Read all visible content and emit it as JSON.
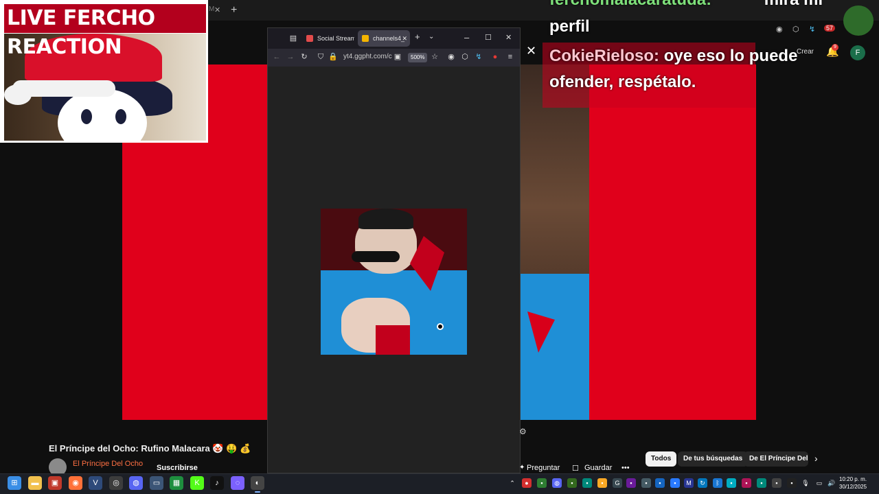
{
  "overlay": {
    "stream_title": "LIVE FERCHO REACTION",
    "chat_lines": [
      {
        "name": "ferchomalacaratuda:",
        "text": "mira mi"
      },
      {
        "name": "",
        "text": "perfil"
      },
      {
        "name": "CokieRieloso:",
        "text": "oye eso lo puede"
      },
      {
        "name": "",
        "text": "ofender, respétalo."
      }
    ]
  },
  "browser_window": {
    "tabs": [
      {
        "label": "Social Stream",
        "active": false,
        "fav_color": "#e24b4b"
      },
      {
        "label": "channels4_",
        "active": true,
        "fav_color": "#f4b400"
      }
    ],
    "url": "yt4.ggpht.com/c",
    "zoom": "500%",
    "new_tab_symbol": "+",
    "controls": {
      "minimize": "–",
      "maximize": "☐",
      "close": "✕"
    }
  },
  "youtube": {
    "video_title": "El Príncipe del Ocho: Rufino Malacara 🤡 🤑 💰",
    "channel_name": "El Príncipe Del Ocho",
    "subscribe_label": "Suscribirse",
    "ask_label": "Preguntar",
    "save_label": "Guardar",
    "more_label": "•••",
    "chips": [
      "Todos",
      "De tus búsquedas",
      "De El Príncipe Del O"
    ],
    "create_label": "Crear",
    "notification_count": "9",
    "avatar_initial": "F",
    "top_badge": "57",
    "close_symbol": "✕"
  },
  "bg_browser": {
    "tab_fragment": "M",
    "tab_close": "✕",
    "new_tab": "+"
  },
  "taskbar": {
    "time": "10:20 p. m.",
    "date": "30/12/2025",
    "apps": [
      {
        "icon": "windows-start-icon",
        "glyph": "⊞",
        "color": "#3a8ee6"
      },
      {
        "icon": "file-explorer-icon",
        "glyph": "▬",
        "color": "#f2c14e"
      },
      {
        "icon": "app-icon",
        "glyph": "▣",
        "color": "#c0392b"
      },
      {
        "icon": "firefox-icon",
        "glyph": "◉",
        "color": "#ff7139"
      },
      {
        "icon": "vegas-icon",
        "glyph": "V",
        "color": "#2e4a7a"
      },
      {
        "icon": "chrome-icon",
        "glyph": "◎",
        "color": "#3c3c3c"
      },
      {
        "icon": "discord-icon",
        "glyph": "◍",
        "color": "#5865f2"
      },
      {
        "icon": "window-icon",
        "glyph": "▭",
        "color": "#3b5576"
      },
      {
        "icon": "sheets-icon",
        "glyph": "▦",
        "color": "#1e8e3e"
      },
      {
        "icon": "kick-icon",
        "glyph": "K",
        "color": "#53fc18"
      },
      {
        "icon": "tiktok-live-icon",
        "glyph": "♪",
        "color": "#111111"
      },
      {
        "icon": "messenger-icon",
        "glyph": "◌",
        "color": "#7b61ff"
      },
      {
        "icon": "obs-icon",
        "glyph": "◐",
        "color": "#444444"
      }
    ]
  },
  "colors": {
    "video_red": "#e0001b",
    "shirt_blue": "#1f8fd6",
    "channel_orange": "#ff7043"
  }
}
